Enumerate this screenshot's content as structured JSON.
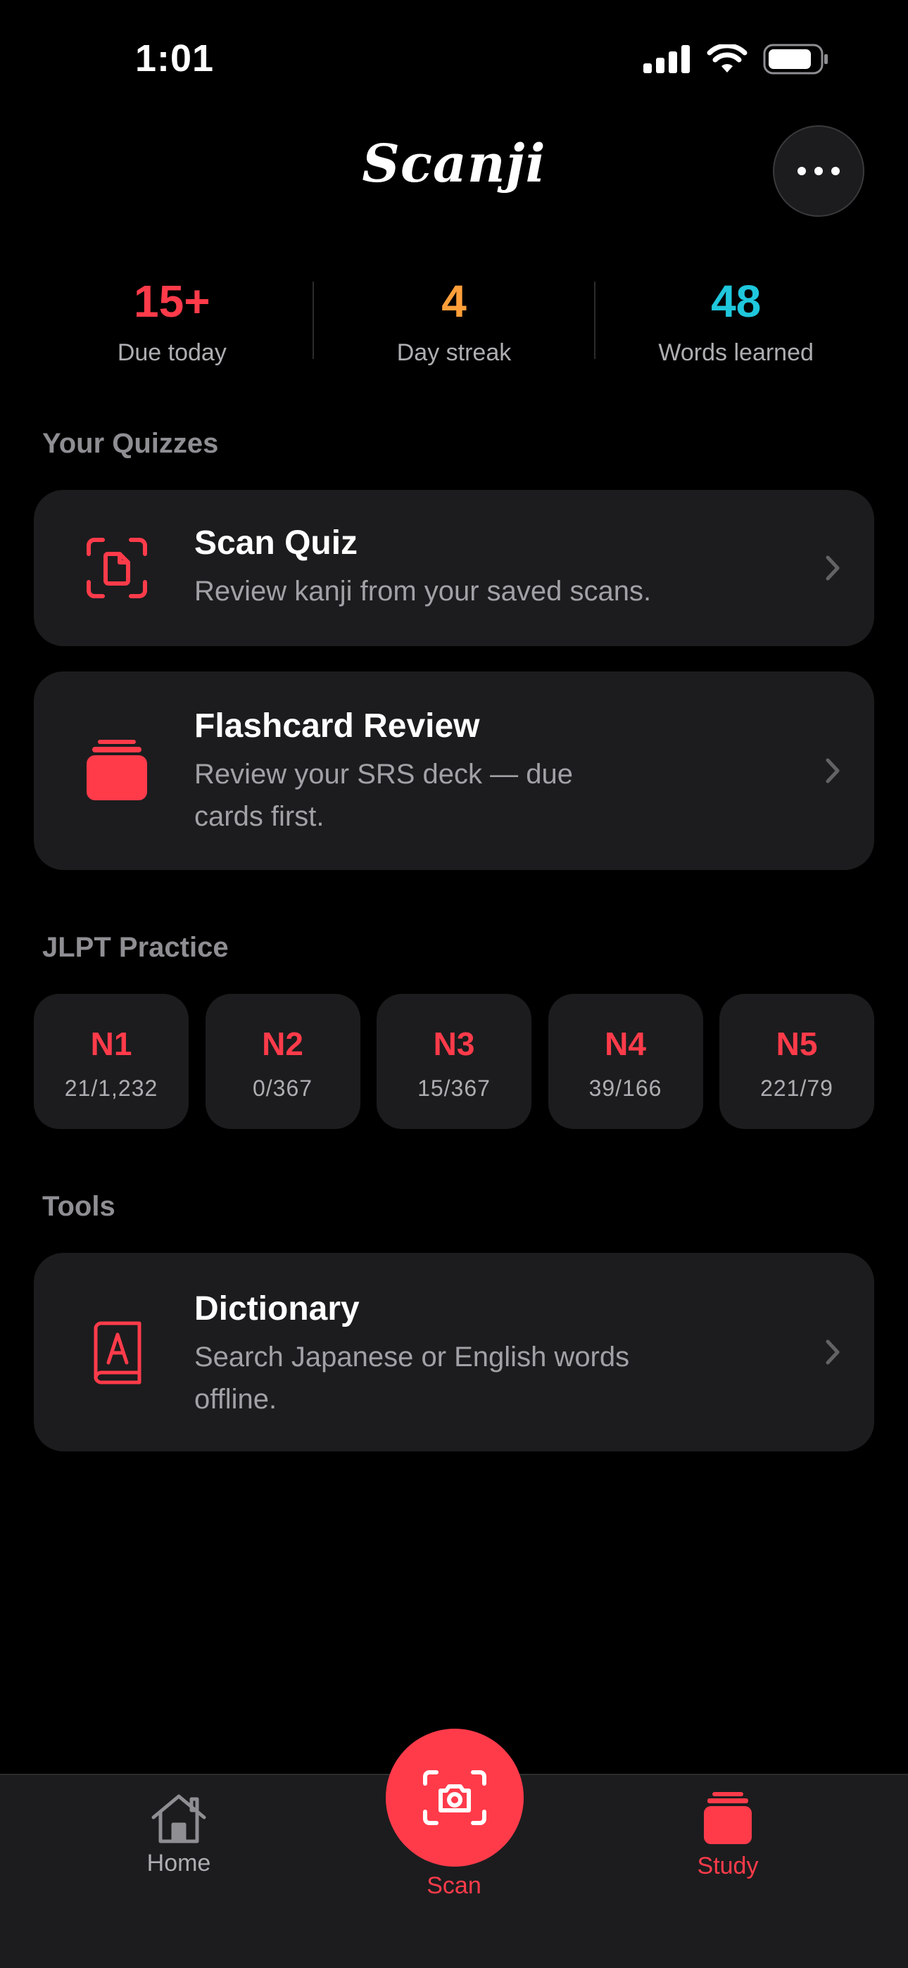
{
  "status": {
    "time": "1:01"
  },
  "header": {
    "title": "Scanji",
    "more_icon": "ellipsis-icon"
  },
  "stats": [
    {
      "value": "15+",
      "label": "Due today",
      "color": "#ff3b4a"
    },
    {
      "value": "4",
      "label": "Day streak",
      "color": "#ff9f3a"
    },
    {
      "value": "48",
      "label": "Words learned",
      "color": "#1fc7dc"
    }
  ],
  "sections": {
    "quizzes": "Your Quizzes",
    "jlpt": "JLPT Practice",
    "tools": "Tools"
  },
  "quizzes": [
    {
      "title": "Scan Quiz",
      "subtitle": "Review kanji from your saved scans.",
      "icon": "scan-document-icon"
    },
    {
      "title": "Flashcard Review",
      "subtitle": "Review your SRS deck — due cards first.",
      "icon": "card-stack-icon"
    }
  ],
  "jlpt": [
    {
      "level": "N1",
      "count": "21/1,232"
    },
    {
      "level": "N2",
      "count": "0/367"
    },
    {
      "level": "N3",
      "count": "15/367"
    },
    {
      "level": "N4",
      "count": "39/166"
    },
    {
      "level": "N5",
      "count": "221/79"
    }
  ],
  "tools": [
    {
      "title": "Dictionary",
      "subtitle": "Search Japanese or English words offline.",
      "icon": "dictionary-icon"
    }
  ],
  "tabbar": {
    "home": "Home",
    "scan": "Scan",
    "study": "Study",
    "accent": "#ff3b4a"
  }
}
